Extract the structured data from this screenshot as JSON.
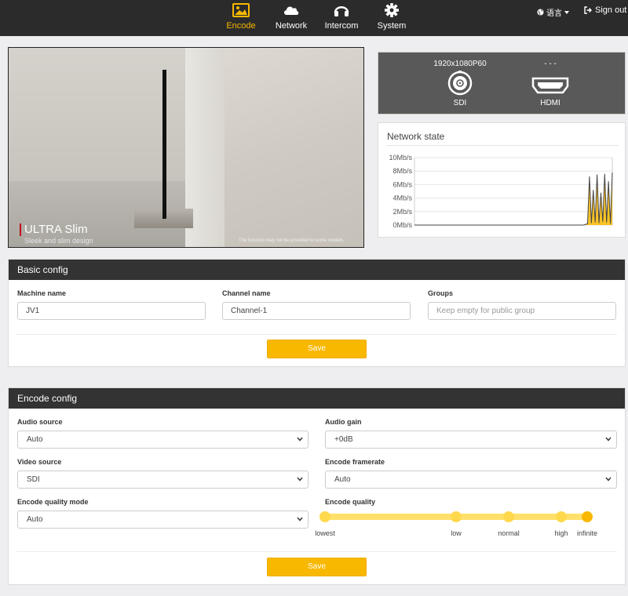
{
  "nav": {
    "items": [
      {
        "label": "Encode",
        "icon": "image-icon",
        "active": true
      },
      {
        "label": "Network",
        "icon": "cloud-icon",
        "active": false
      },
      {
        "label": "Intercom",
        "icon": "headset-icon",
        "active": false
      },
      {
        "label": "System",
        "icon": "gear-icon",
        "active": false
      }
    ],
    "language_label": "语言",
    "signout_label": "Sign out"
  },
  "preview": {
    "headline": "ULTRA Slim",
    "tagline": "Sleek and slim design",
    "fineprint": "The function may not be provided to some models"
  },
  "ports": {
    "sdi": {
      "resolution": "1920x1080P60",
      "name": "SDI"
    },
    "hdmi": {
      "resolution": "- - -",
      "name": "HDMI"
    }
  },
  "network_state": {
    "title": "Network state"
  },
  "chart_data": {
    "type": "area",
    "title": "Network state",
    "yticks": [
      "10Mb/s",
      "8Mb/s",
      "6Mb/s",
      "4Mb/s",
      "2Mb/s",
      "0Mb/s"
    ],
    "ylim": [
      0,
      10
    ],
    "series": [
      {
        "color": "#f9b800",
        "values": [
          0,
          0,
          0,
          0,
          0,
          0,
          0,
          0,
          0,
          0,
          0,
          0,
          0,
          0,
          0,
          0,
          0,
          0,
          0,
          0,
          0,
          0,
          0,
          0,
          0,
          0,
          0,
          0,
          0,
          0,
          0,
          0,
          0,
          0,
          0,
          0,
          0,
          0,
          0,
          0,
          0,
          0,
          0,
          0,
          0,
          0,
          0,
          0,
          0,
          0,
          0,
          0,
          0,
          0,
          0,
          0,
          0,
          0,
          0,
          0,
          0,
          0,
          0,
          0,
          0,
          0,
          0,
          0,
          0,
          0,
          0,
          0,
          0,
          0,
          0,
          0,
          0,
          0,
          0,
          0,
          0,
          0,
          0,
          0,
          0,
          0,
          0,
          0,
          0,
          0,
          0.1,
          0.2,
          7.2,
          0.3,
          5.2,
          0.4,
          7.5,
          0.3,
          4.8,
          0.5,
          7.6,
          0.4,
          6.5,
          0.2,
          7.8
        ]
      }
    ]
  },
  "basic_config": {
    "title": "Basic config",
    "machine_name_label": "Machine name",
    "machine_name_value": "JV1",
    "channel_name_label": "Channel name",
    "channel_name_value": "Channel-1",
    "groups_label": "Groups",
    "groups_placeholder": "Keep empty for public group",
    "save_label": "Save"
  },
  "encode_config": {
    "title": "Encode config",
    "audio_source_label": "Audio source",
    "audio_source_value": "Auto",
    "audio_gain_label": "Audio gain",
    "audio_gain_value": "+0dB",
    "video_source_label": "Video source",
    "video_source_value": "SDI",
    "encode_framerate_label": "Encode framerate",
    "encode_framerate_value": "Auto",
    "quality_mode_label": "Encode quality mode",
    "quality_mode_value": "Auto",
    "quality_label": "Encode quality",
    "quality_levels": [
      "lowest",
      "low",
      "normal",
      "high",
      "infinite"
    ],
    "quality_selected": "infinite",
    "save_label": "Save"
  },
  "colors": {
    "accent": "#f9b800",
    "topbar": "#2b2b2b",
    "panel_header": "#333333",
    "port_bg": "#595959"
  }
}
